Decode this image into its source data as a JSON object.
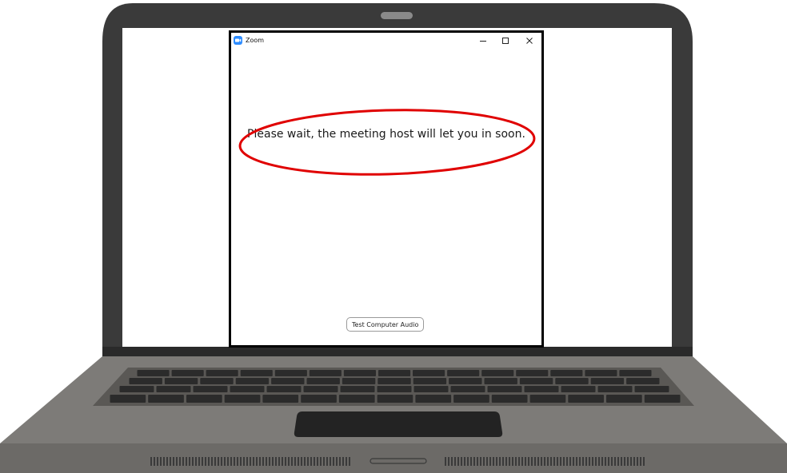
{
  "window": {
    "app_icon": "zoom-logo-icon",
    "title": "Zoom",
    "controls": [
      "minimize-icon",
      "maximize-icon",
      "close-icon"
    ]
  },
  "main": {
    "message": "Please wait, the meeting host will let you in soon.",
    "highlight_color": "#e00000"
  },
  "footer": {
    "test_audio_label": "Test Computer Audio"
  },
  "colors": {
    "zoom_brand": "#2d8cff",
    "laptop_body": "#7d7b78",
    "laptop_bezel": "#3a3a3a",
    "keyboard_deck": "#5f5d5a",
    "keys": "#2b2b2b"
  }
}
